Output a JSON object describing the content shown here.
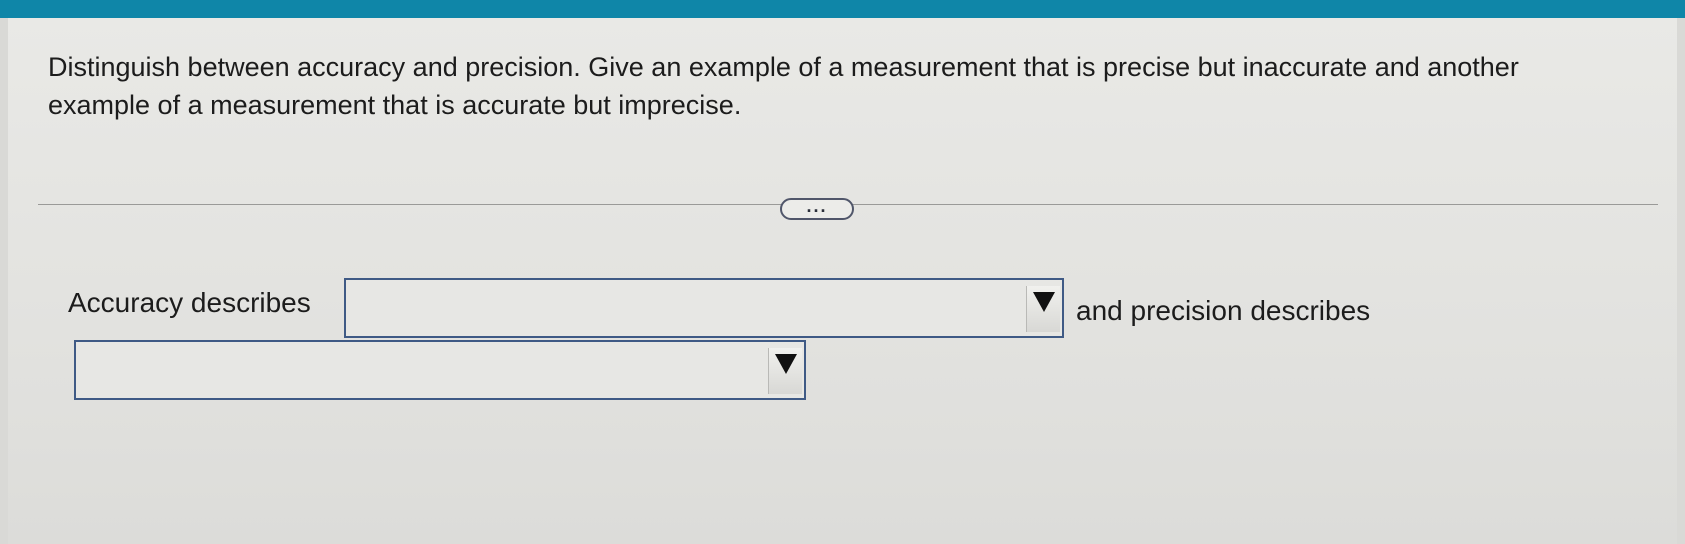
{
  "question": {
    "text": "Distinguish between accuracy and precision. Give an example of a measurement that is precise but inaccurate and another example of a measurement that is accurate but imprecise."
  },
  "expand_button": {
    "label": "..."
  },
  "answer": {
    "prefix": "Accuracy describes",
    "middle": "and precision describes",
    "dropdown_1": {
      "selected": ""
    },
    "dropdown_2": {
      "selected": ""
    }
  },
  "icons": {
    "dropdown_arrow": "triangle-down-icon"
  },
  "colors": {
    "header_bar": "#0f86a8",
    "dropdown_border": "#3f5a85"
  }
}
